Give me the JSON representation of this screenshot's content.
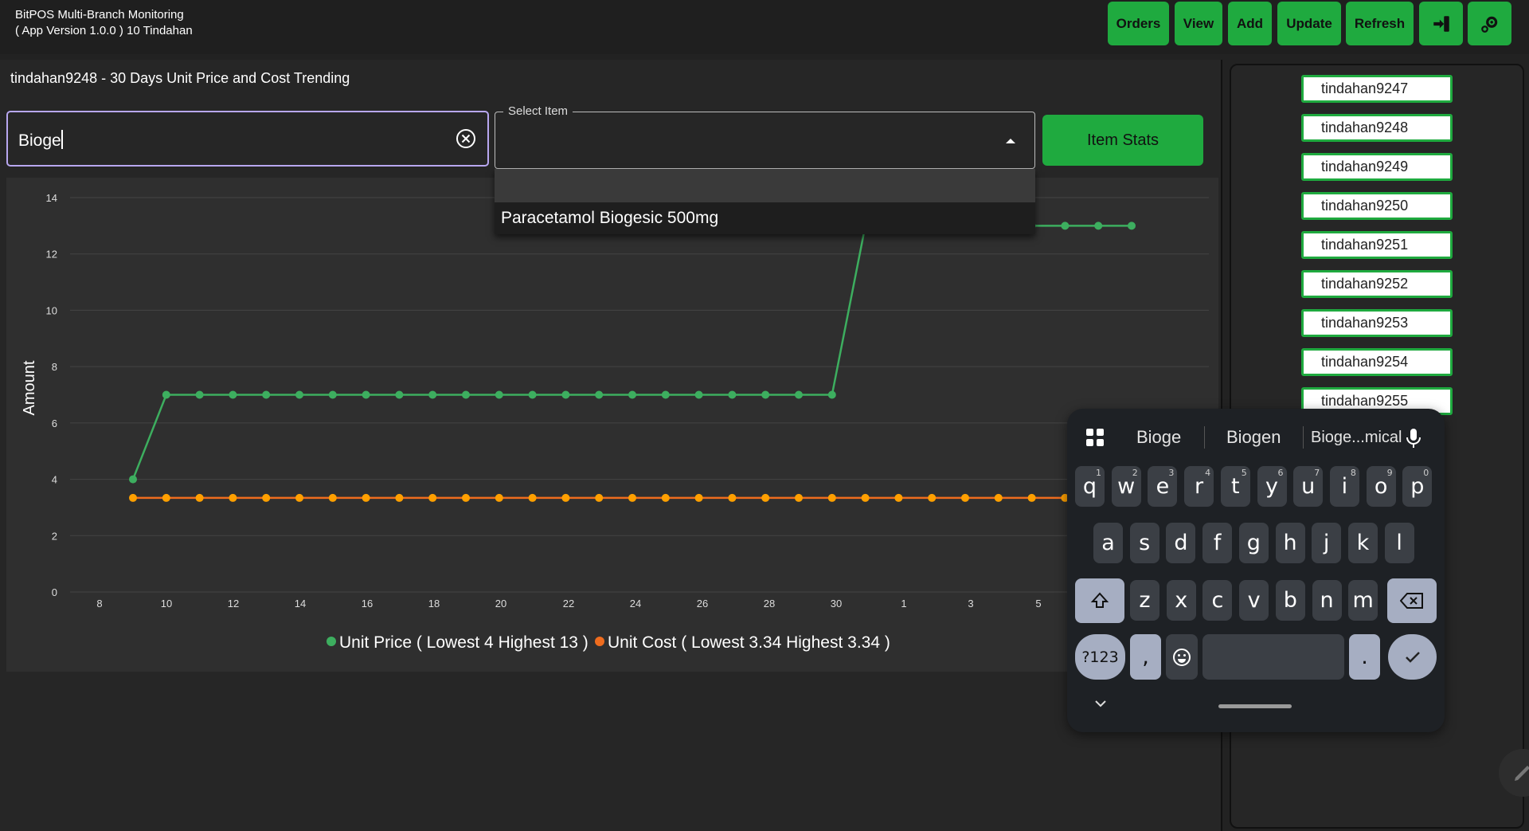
{
  "header": {
    "title_line1": "BitPOS Multi-Branch Monitoring",
    "title_line2": "( App Version 1.0.0 ) 10 Tindahan",
    "buttons": {
      "orders": "Orders",
      "view": "View",
      "add": "Add",
      "update": "Update",
      "refresh": "Refresh"
    },
    "icons": {
      "logout": "logout-icon",
      "settings": "settings-gear-icon"
    },
    "accent_color": "#1faa3f"
  },
  "panel": {
    "title": "tindahan9248 - 30 Days Unit Price and Cost Trending"
  },
  "search": {
    "value": "Bioge"
  },
  "select": {
    "label": "Select Item",
    "value": "",
    "options": [
      "",
      "Paracetamol Biogesic 500mg"
    ]
  },
  "item_stats_button": "Item Stats",
  "branches": [
    "tindahan9247",
    "tindahan9248",
    "tindahan9249",
    "tindahan9250",
    "tindahan9251",
    "tindahan9252",
    "tindahan9253",
    "tindahan9254",
    "tindahan9255"
  ],
  "keyboard": {
    "suggestions": [
      "Bioge",
      "Biogen",
      "Bioge...mical"
    ],
    "row1": [
      [
        "q",
        "1"
      ],
      [
        "w",
        "2"
      ],
      [
        "e",
        "3"
      ],
      [
        "r",
        "4"
      ],
      [
        "t",
        "5"
      ],
      [
        "y",
        "6"
      ],
      [
        "u",
        "7"
      ],
      [
        "i",
        "8"
      ],
      [
        "o",
        "9"
      ],
      [
        "p",
        "0"
      ]
    ],
    "row2": [
      "a",
      "s",
      "d",
      "f",
      "g",
      "h",
      "j",
      "k",
      "l"
    ],
    "row3": [
      "z",
      "x",
      "c",
      "v",
      "b",
      "n",
      "m"
    ],
    "symbols_key": "?123",
    "comma_key": ",",
    "period_key": "."
  },
  "chart_data": {
    "type": "line",
    "ylabel": "Amount",
    "ylim": [
      0,
      14
    ],
    "yticks": [
      0,
      2,
      4,
      6,
      8,
      10,
      12,
      14
    ],
    "x_tick_labels": [
      "8",
      "10",
      "12",
      "14",
      "16",
      "18",
      "20",
      "22",
      "24",
      "26",
      "28",
      "30",
      "1",
      "3",
      "5"
    ],
    "x": [
      "9",
      "10",
      "11",
      "12",
      "13",
      "14",
      "15",
      "16",
      "17",
      "18",
      "19",
      "20",
      "21",
      "22",
      "23",
      "24",
      "25",
      "26",
      "27",
      "28",
      "29",
      "30",
      "31",
      "1",
      "2",
      "3",
      "4",
      "5",
      "6",
      "7",
      "8"
    ],
    "grid": true,
    "legend_position": "bottom",
    "series": [
      {
        "name": "Unit Price ( Lowest 4 Highest 13 )",
        "color": "#3dae5f",
        "values": [
          4,
          7,
          7,
          7,
          7,
          7,
          7,
          7,
          7,
          7,
          7,
          7,
          7,
          7,
          7,
          7,
          7,
          7,
          7,
          7,
          7,
          7,
          13,
          13,
          13,
          13,
          13,
          13,
          13,
          13,
          13
        ]
      },
      {
        "name": "Unit Cost ( Lowest 3.34 Highest 3.34 )",
        "color": "#ef6c1e",
        "values": [
          3.34,
          3.34,
          3.34,
          3.34,
          3.34,
          3.34,
          3.34,
          3.34,
          3.34,
          3.34,
          3.34,
          3.34,
          3.34,
          3.34,
          3.34,
          3.34,
          3.34,
          3.34,
          3.34,
          3.34,
          3.34,
          3.34,
          3.34,
          3.34,
          3.34,
          3.34,
          3.34,
          3.34,
          3.34,
          3.34,
          3.34
        ]
      }
    ],
    "point_color_unit_cost": "#ffa000"
  }
}
